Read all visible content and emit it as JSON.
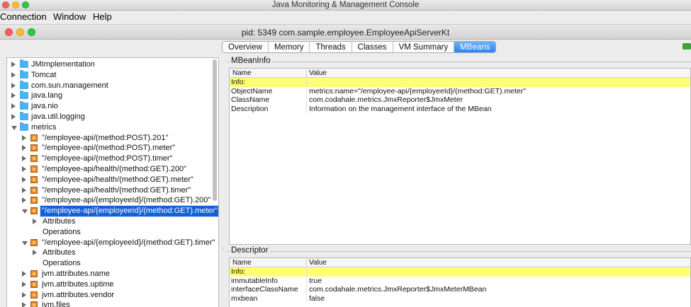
{
  "app": {
    "title": "Java Monitoring & Management Console"
  },
  "menu": [
    {
      "label": "Connection"
    },
    {
      "label": "Window"
    },
    {
      "label": "Help"
    }
  ],
  "window": {
    "title": "pid: 5349 com.sample.employee.EmployeeApiServerKt"
  },
  "tabs": [
    {
      "label": "Overview",
      "active": false
    },
    {
      "label": "Memory",
      "active": false
    },
    {
      "label": "Threads",
      "active": false
    },
    {
      "label": "Classes",
      "active": false
    },
    {
      "label": "VM Summary",
      "active": false
    },
    {
      "label": "MBeans",
      "active": true
    }
  ],
  "tree": [
    {
      "label": "JMImplementation",
      "icon": "folder-icon",
      "state": "closed",
      "indent": 0
    },
    {
      "label": "Tomcat",
      "icon": "folder-icon",
      "state": "closed",
      "indent": 0
    },
    {
      "label": "com.sun.management",
      "icon": "folder-icon",
      "state": "closed",
      "indent": 0
    },
    {
      "label": "java.lang",
      "icon": "folder-icon",
      "state": "closed",
      "indent": 0
    },
    {
      "label": "java.nio",
      "icon": "folder-icon",
      "state": "closed",
      "indent": 0
    },
    {
      "label": "java.util.logging",
      "icon": "folder-icon",
      "state": "closed",
      "indent": 0
    },
    {
      "label": "metrics",
      "icon": "folder-icon",
      "state": "open",
      "indent": 0
    },
    {
      "label": "\"/employee-api/(method:POST).201\"",
      "icon": "bean-icon",
      "state": "closed",
      "indent": 1
    },
    {
      "label": "\"/employee-api/(method:POST).meter\"",
      "icon": "bean-icon",
      "state": "closed",
      "indent": 1
    },
    {
      "label": "\"/employee-api/(method:POST).timer\"",
      "icon": "bean-icon",
      "state": "closed",
      "indent": 1
    },
    {
      "label": "\"/employee-api/health/(method:GET).200\"",
      "icon": "bean-icon",
      "state": "closed",
      "indent": 1
    },
    {
      "label": "\"/employee-api/health/(method:GET).meter\"",
      "icon": "bean-icon",
      "state": "closed",
      "indent": 1
    },
    {
      "label": "\"/employee-api/health/(method:GET).timer\"",
      "icon": "bean-icon",
      "state": "closed",
      "indent": 1
    },
    {
      "label": "\"/employee-api/{employeeId}/(method:GET).200\"",
      "icon": "bean-icon",
      "state": "closed",
      "indent": 1
    },
    {
      "label": "\"/employee-api/{employeeId}/(method:GET).meter\"",
      "icon": "bean-icon",
      "state": "open",
      "indent": 1,
      "selected": true
    },
    {
      "label": "Attributes",
      "icon": "",
      "state": "closed",
      "indent": 2
    },
    {
      "label": "Operations",
      "icon": "",
      "state": "none",
      "indent": 2
    },
    {
      "label": "\"/employee-api/{employeeId}/(method:GET).timer\"",
      "icon": "bean-icon",
      "state": "open",
      "indent": 1
    },
    {
      "label": "Attributes",
      "icon": "",
      "state": "closed",
      "indent": 2
    },
    {
      "label": "Operations",
      "icon": "",
      "state": "none",
      "indent": 2
    },
    {
      "label": "jvm.attributes.name",
      "icon": "bean-icon",
      "state": "closed",
      "indent": 1
    },
    {
      "label": "jvm.attributes.uptime",
      "icon": "bean-icon",
      "state": "closed",
      "indent": 1
    },
    {
      "label": "jvm.attributes.vendor",
      "icon": "bean-icon",
      "state": "closed",
      "indent": 1
    },
    {
      "label": "jvm.files",
      "icon": "bean-icon",
      "state": "closed",
      "indent": 1
    }
  ],
  "mbeaninfo": {
    "title": "MBeanInfo",
    "col_name": "Name",
    "col_value": "Value",
    "rows": [
      {
        "name": "Info:",
        "value": "",
        "info": true
      },
      {
        "name": "ObjectName",
        "value": "metrics:name=\"/employee-api/{employeeId}/(method:GET).meter\""
      },
      {
        "name": "ClassName",
        "value": "com.codahale.metrics.JmxReporter$JmxMeter"
      },
      {
        "name": "Description",
        "value": "Information on the management interface of the MBean"
      }
    ]
  },
  "descriptor": {
    "title": "Descriptor",
    "col_name": "Name",
    "col_value": "Value",
    "rows": [
      {
        "name": "Info:",
        "value": "",
        "info": true
      },
      {
        "name": "immutableInfo",
        "value": "true"
      },
      {
        "name": "interfaceClassName",
        "value": "com.codahale.metrics.JmxReporter$JmxMeterMBean"
      },
      {
        "name": "mxbean",
        "value": "false"
      }
    ]
  },
  "colors": {
    "selection": "#1560d4",
    "info_highlight": "#ffff73",
    "tab_active": "#2a85f7"
  }
}
